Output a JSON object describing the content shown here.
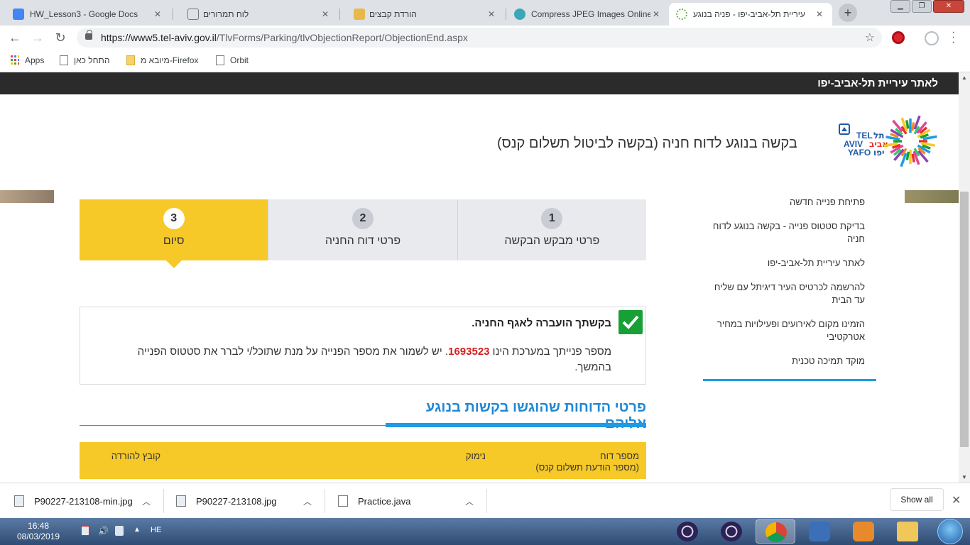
{
  "browser": {
    "tabs": [
      {
        "title": "HW_Lesson3 - Google Docs",
        "icon": "google-docs-icon",
        "color": "#4285f4"
      },
      {
        "title": "לוח תמרורים",
        "icon": "document-icon",
        "color": "#ffffff"
      },
      {
        "title": "הורדת קבצים",
        "icon": "download-page-icon",
        "color": "#e8b84b"
      },
      {
        "title": "Compress JPEG Images Online",
        "icon": "compress-icon",
        "color": "#3aa7b6"
      },
      {
        "title": "עיריית תל-אביב-יפו - פניה בנוגע",
        "icon": "tel-aviv-icon",
        "color": "#6fb34a"
      }
    ],
    "url_main": "https://www5.tel-aviv.gov.il",
    "url_path": "/TlvForms/Parking/tlvObjectionReport/ObjectionEnd.aspx",
    "bookmarks": [
      {
        "label": "Apps",
        "icon": "apps-grid-icon"
      },
      {
        "label": "התחל כאן",
        "icon": "page-icon"
      },
      {
        "label": "מיובא מ-Firefox",
        "icon": "folder-icon"
      },
      {
        "label": "Orbit",
        "icon": "page-icon"
      }
    ]
  },
  "site": {
    "top_link": "לאתר עיריית תל-אביב-יפו",
    "page_title": "בקשה בנוגע לדוח חניה (בקשה לביטול תשלום קנס)",
    "logo_en": "TEL AVIV YAFO",
    "logo_he": "תל אביב יפו",
    "sidebar": [
      "פתיחת פנייה חדשה",
      "בדיקת סטטוס פנייה - בקשה בנוגע לדוח חניה",
      "לאתר עיריית תל-אביב-יפו",
      "להרשמה לכרטיס העיר דיגיתל עם שליח עד הבית",
      "הזמינו מקום לאירועים ופעילויות במחיר אטרקטיבי",
      "מוקד תמיכה טכנית"
    ],
    "steps": [
      {
        "num": "3",
        "label": "סיום",
        "active": true
      },
      {
        "num": "2",
        "label": "פרטי דוח החניה",
        "active": false
      },
      {
        "num": "1",
        "label": "פרטי מבקש הבקשה",
        "active": false
      }
    ],
    "confirm": {
      "heading": "בקשתך הועברה לאגף החניה.",
      "text_before": "מספר פנייתך במערכת הינו ",
      "request_number": "1693523",
      "text_after": ". יש לשמור את מספר הפנייה על מנת שתוכל/י לברר את סטטוס הפנייה בהמשך."
    },
    "section_title": "פרטי הדוחות שהוגשו בקשות בנוגע אליהם",
    "table_headers": {
      "report_number": "מספר דוח",
      "report_number_sub": "(מספר הודעת תשלום קנס)",
      "reason": "נימוק",
      "download": "קובץ להורדה"
    },
    "colors": {
      "accent_yellow": "#f6c928",
      "accent_blue": "#1e9be5",
      "success_green": "#17a035",
      "number_red": "#d31f1f"
    }
  },
  "downloads": [
    {
      "name": "P90227-213108-min.jpg",
      "icon": "image-file-icon"
    },
    {
      "name": "P90227-213108.jpg",
      "icon": "image-file-icon"
    },
    {
      "name": "Practice.java",
      "icon": "file-icon"
    }
  ],
  "downloads_show_all": "Show all",
  "taskbar": {
    "time": "16:48",
    "date": "08/03/2019",
    "lang": "HE"
  }
}
